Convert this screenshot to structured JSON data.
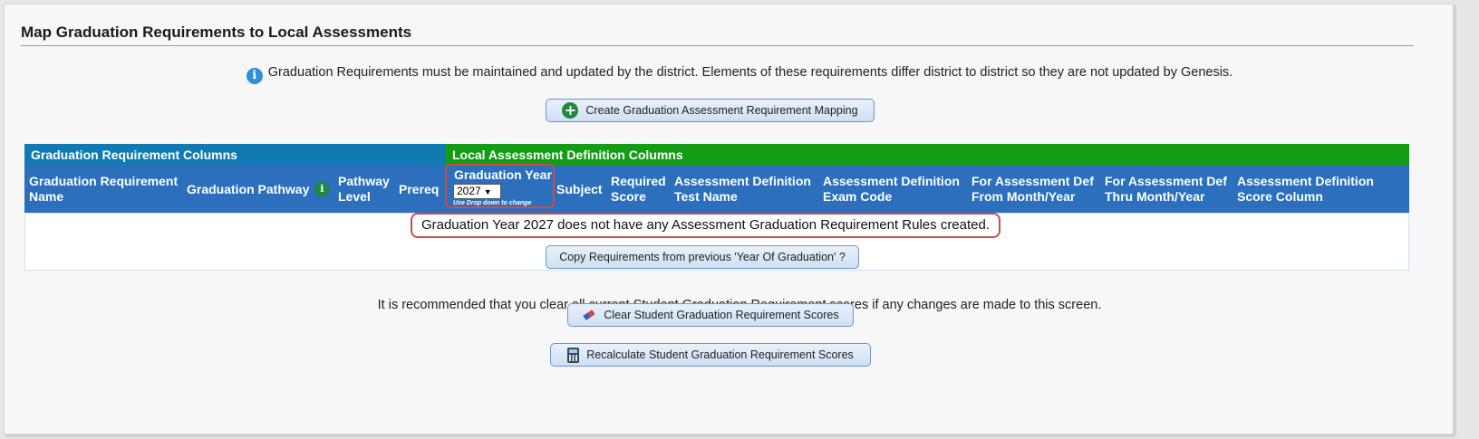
{
  "page": {
    "title": "Map Graduation Requirements to Local Assessments",
    "info_text": "Graduation Requirements must be maintained and updated by the district. Elements of these requirements differ district to district so they are not updated by Genesis."
  },
  "buttons": {
    "create_mapping": "Create Graduation Assessment Requirement Mapping",
    "copy_requirements": "Copy Requirements from previous 'Year Of Graduation' ?",
    "clear_scores": "Clear Student Graduation Requirement Scores",
    "recalculate_scores": "Recalculate Student Graduation Requirement Scores"
  },
  "table": {
    "group_headers": {
      "graduation": "Graduation Requirement Columns",
      "local": "Local Assessment Definition Columns"
    },
    "columns": {
      "req_name_1": "Graduation Requirement",
      "req_name_2": "Name",
      "pathway": "Graduation Pathway",
      "pathway_level_1": "Pathway",
      "pathway_level_2": "Level",
      "prereq": "Prereq",
      "grad_year": "Graduation Year",
      "grad_year_hint": "Use Drop down to change",
      "subject": "Subject",
      "required_score_1": "Required",
      "required_score_2": "Score",
      "test_name_1": "Assessment Definition",
      "test_name_2": "Test Name",
      "exam_code_1": "Assessment Definition",
      "exam_code_2": "Exam Code",
      "from_1": "For Assessment Def",
      "from_2": "From Month/Year",
      "thru_1": "For Assessment Def",
      "thru_2": "Thru Month/Year",
      "score_col_1": "Assessment Definition",
      "score_col_2": "Score Column"
    },
    "grad_year_selected": "2027",
    "empty_message": "Graduation Year 2027 does not have any Assessment Graduation Requirement Rules created."
  },
  "recommendation": "It is recommended that you clear all current Student Graduation Requirement scores if any changes are made to this screen.",
  "colors": {
    "grad_header": "#127ab3",
    "local_header": "#139c14",
    "column_header": "#2b6fbd",
    "highlight": "#d24b40"
  },
  "icons": [
    "info-icon",
    "plus-icon",
    "pathway-info-icon",
    "eraser-icon",
    "calculator-icon"
  ]
}
